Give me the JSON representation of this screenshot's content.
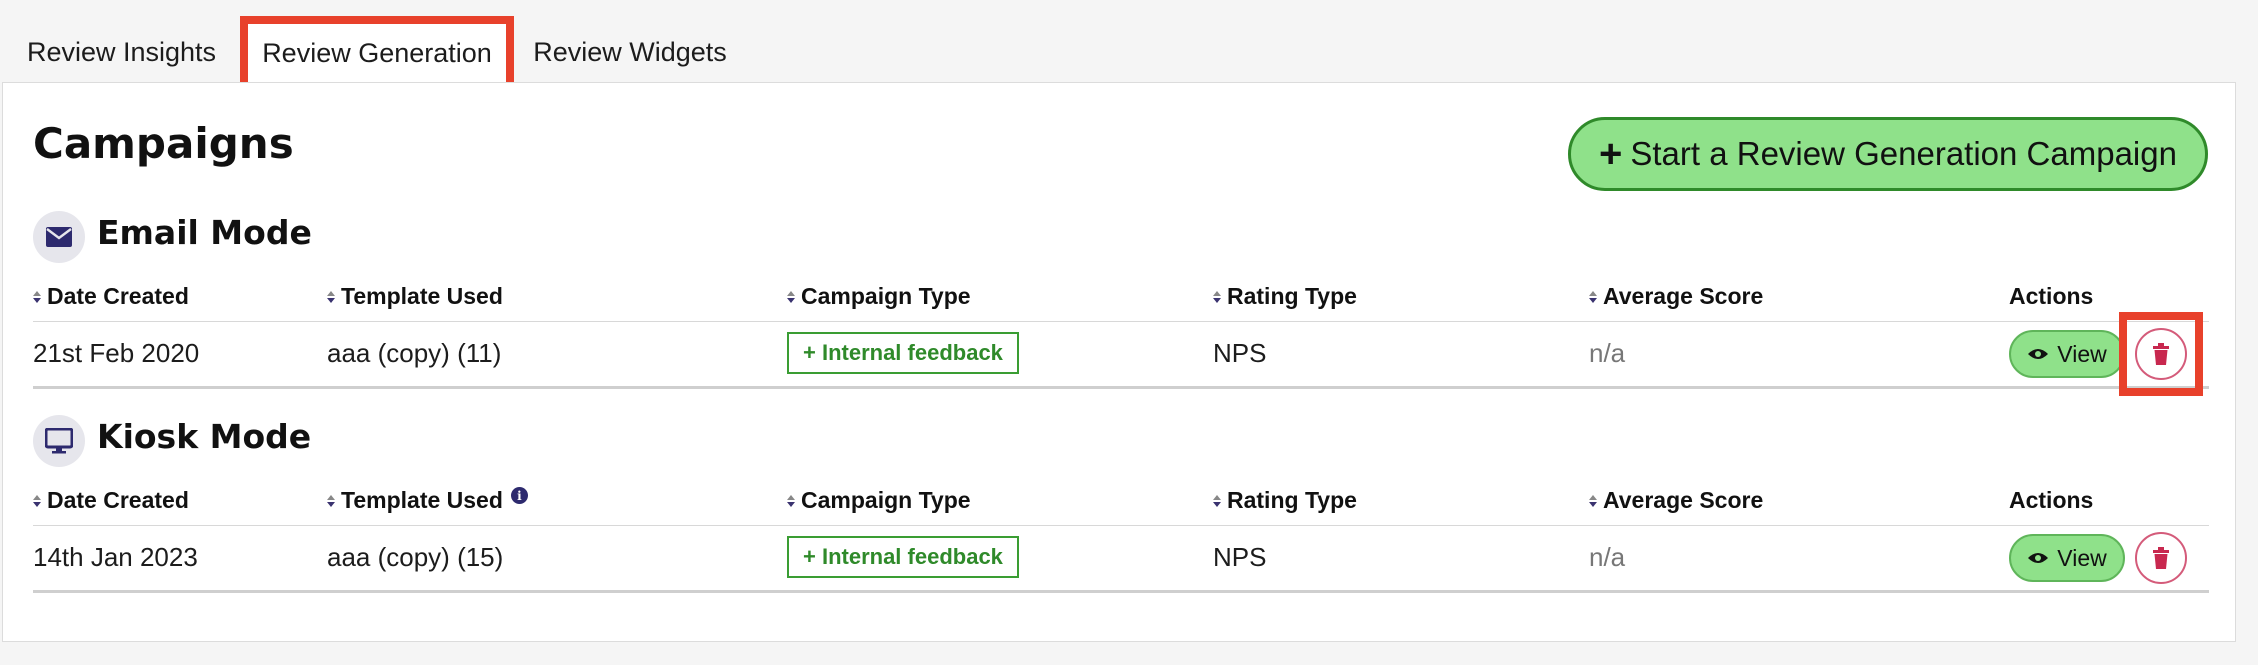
{
  "tabs": [
    {
      "label": "Review Insights",
      "active": false
    },
    {
      "label": "Review Generation",
      "active": true
    },
    {
      "label": "Review Widgets",
      "active": false
    }
  ],
  "page": {
    "title": "Campaigns",
    "start_button_plus": "+",
    "start_button_label": "Start a Review Generation Campaign"
  },
  "columns": {
    "date_created": "Date Created",
    "template_used": "Template Used",
    "campaign_type": "Campaign Type",
    "rating_type": "Rating Type",
    "average_score": "Average Score",
    "actions": "Actions"
  },
  "sections": {
    "email": {
      "title": "Email Mode",
      "icon": "envelope-icon",
      "rows": [
        {
          "date_created": "21st Feb 2020",
          "template_used": "aaa (copy) (11)",
          "campaign_type": "+ Internal feedback",
          "rating_type": "NPS",
          "average_score": "n/a",
          "view_label": "View"
        }
      ]
    },
    "kiosk": {
      "title": "Kiosk Mode",
      "icon": "monitor-icon",
      "template_info_icon": "i",
      "rows": [
        {
          "date_created": "14th Jan 2023",
          "template_used": "aaa (copy) (15)",
          "campaign_type": "+ Internal feedback",
          "rating_type": "NPS",
          "average_score": "n/a",
          "view_label": "View"
        }
      ]
    }
  },
  "colors": {
    "highlight": "#e8412b",
    "button_green": "#8fe18a",
    "badge_green": "#2f8a2a",
    "trash_red": "#c8284f",
    "icon_navy": "#2d2a6e"
  }
}
